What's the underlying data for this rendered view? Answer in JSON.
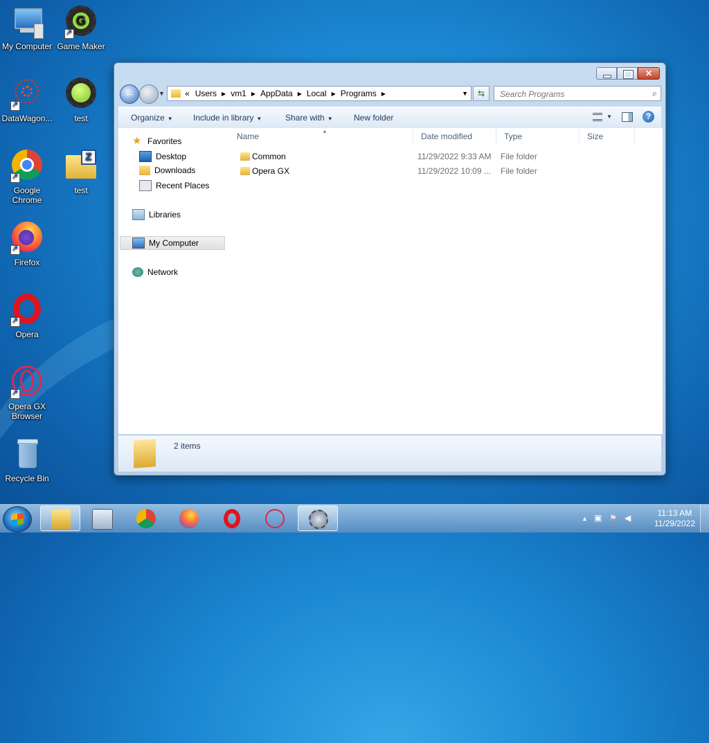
{
  "desktop": {
    "icons": [
      {
        "label": "My Computer"
      },
      {
        "label": "Game Maker"
      },
      {
        "label": "DataWagon..."
      },
      {
        "label": "test"
      },
      {
        "label": "Google Chrome"
      },
      {
        "label": "test"
      },
      {
        "label": "Firefox"
      },
      {
        "label": "Opera"
      },
      {
        "label": "Opera GX Browser"
      },
      {
        "label": "Recycle Bin"
      }
    ]
  },
  "window": {
    "address": {
      "overflow": "«",
      "crumbs": [
        "Users",
        "vm1",
        "AppData",
        "Local",
        "Programs"
      ]
    },
    "search": {
      "placeholder": "Search Programs"
    },
    "toolbar": {
      "organize": "Organize",
      "include_library": "Include in library",
      "share_with": "Share with",
      "new_folder": "New folder"
    },
    "nav": {
      "favorites": "Favorites",
      "desktop": "Desktop",
      "downloads": "Downloads",
      "recent_places": "Recent Places",
      "libraries": "Libraries",
      "my_computer": "My Computer",
      "network": "Network"
    },
    "columns": {
      "name": "Name",
      "date": "Date modified",
      "type": "Type",
      "size": "Size"
    },
    "files": [
      {
        "name": "Common",
        "date": "11/29/2022 9:33 AM",
        "type": "File folder"
      },
      {
        "name": "Opera GX",
        "date": "11/29/2022 10:09 ...",
        "type": "File folder"
      }
    ],
    "status": {
      "count": "2 items"
    }
  },
  "taskbar": {
    "clock_time": "11:13 AM",
    "clock_date": "11/29/2022"
  },
  "colors": {
    "accent": "#1f6fc0",
    "desktop": "#1b87d2"
  }
}
